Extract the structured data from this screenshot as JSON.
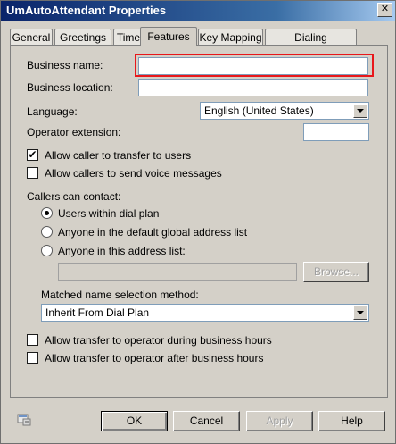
{
  "window": {
    "title": "UmAutoAttendant Properties",
    "close_glyph": "✕"
  },
  "tabs": [
    {
      "label": "General"
    },
    {
      "label": "Greetings"
    },
    {
      "label": "Times"
    },
    {
      "label": "Features"
    },
    {
      "label": "Key Mapping"
    },
    {
      "label": "Dialing Restrictions"
    }
  ],
  "form": {
    "business_name_label": "Business name:",
    "business_name_value": "",
    "business_location_label": "Business location:",
    "business_location_value": "",
    "language_label": "Language:",
    "language_value": "English (United States)",
    "operator_extension_label": "Operator extension:",
    "operator_extension_value": "",
    "allow_transfer_label": "Allow caller to transfer to users",
    "allow_transfer_checked": true,
    "allow_voice_label": "Allow callers to send voice messages",
    "allow_voice_checked": false,
    "callers_can_contact_label": "Callers can contact:",
    "radio_dial_plan_label": "Users within dial plan",
    "radio_global_label": "Anyone in the default global address list",
    "radio_address_list_label": "Anyone in this address list:",
    "address_list_value": "",
    "browse_label": "Browse...",
    "matched_name_label": "Matched name selection method:",
    "matched_name_value": "Inherit From Dial Plan",
    "transfer_business_label": "Allow transfer to operator during business hours",
    "transfer_after_label": "Allow transfer to operator after business hours"
  },
  "footer": {
    "ok_label": "OK",
    "cancel_label": "Cancel",
    "apply_label": "Apply",
    "help_label": "Help"
  },
  "colors": {
    "highlight": "#e8171b",
    "titlebar": "#0a246a"
  }
}
